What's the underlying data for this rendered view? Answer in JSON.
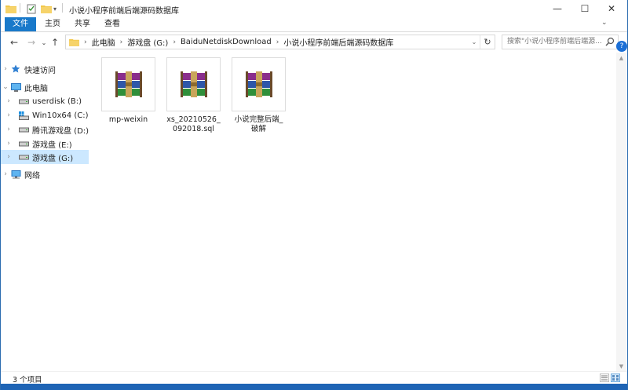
{
  "window": {
    "title": "小说小程序前端后端源码数据库",
    "minimize_glyph": "—",
    "maximize_glyph": "☐",
    "close_glyph": "✕"
  },
  "ribbon": {
    "tabs": [
      "文件",
      "主页",
      "共享",
      "查看"
    ],
    "expand_glyph": "⌄"
  },
  "navigation": {
    "back_glyph": "←",
    "forward_glyph": "→",
    "recent_glyph": "⌄",
    "up_glyph": "↑",
    "breadcrumb": [
      "此电脑",
      "游戏盘 (G:)",
      "BaiduNetdiskDownload",
      "小说小程序前端后端源码数据库"
    ],
    "refresh_glyph": "↻",
    "dropdown_glyph": "⌄"
  },
  "search": {
    "placeholder": "搜索\"小说小程序前端后端源..."
  },
  "sidebar": {
    "items": [
      {
        "label": "快速访问",
        "icon": "star-icon"
      },
      {
        "label": "此电脑",
        "icon": "computer-icon"
      },
      {
        "label": "userdisk (B:)",
        "icon": "drive-icon"
      },
      {
        "label": "Win10x64 (C:)",
        "icon": "system-drive-icon"
      },
      {
        "label": "腾讯游戏盘 (D:)",
        "icon": "drive-icon"
      },
      {
        "label": "游戏盘 (E:)",
        "icon": "drive-icon"
      },
      {
        "label": "游戏盘 (G:)",
        "icon": "drive-icon"
      },
      {
        "label": "网络",
        "icon": "network-icon"
      }
    ]
  },
  "files": [
    {
      "name": "mp-weixin",
      "icon": "winrar-archive-icon"
    },
    {
      "name": "xs_20210526_092018.sql",
      "icon": "winrar-archive-icon"
    },
    {
      "name": "小说完整后端_破解",
      "icon": "winrar-archive-icon"
    }
  ],
  "status": {
    "item_count": "3 个项目"
  },
  "help_glyph": "?",
  "colors": {
    "accent": "#1979ca",
    "selection": "#cce8ff",
    "folder": "#f2c84b"
  }
}
